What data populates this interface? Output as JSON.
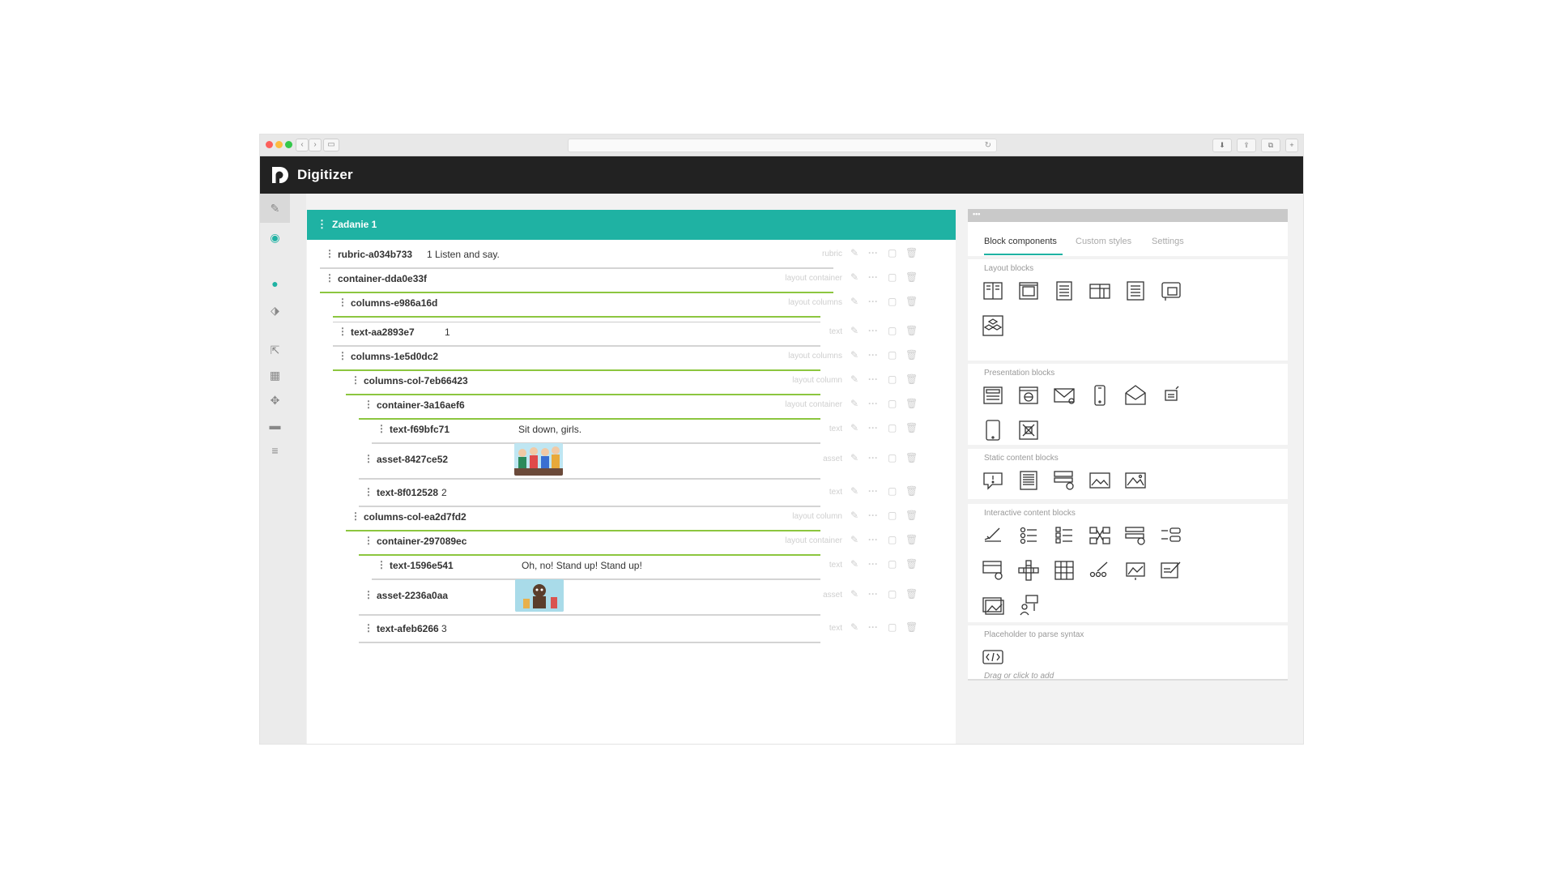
{
  "app": {
    "title": "Digitizer"
  },
  "task": {
    "title": "Zadanie 1"
  },
  "tree": [
    {
      "id": "rubric-a034b733",
      "value": "1 Listen and say.",
      "type": "rubric",
      "kind": "text"
    },
    {
      "id": "container-dda0e33f",
      "value": "",
      "type": "layout container",
      "kind": "text"
    },
    {
      "id": "columns-e986a16d",
      "value": "",
      "type": "layout columns",
      "kind": "text"
    },
    {
      "id": "text-aa2893e7",
      "value": "1",
      "type": "text",
      "kind": "text"
    },
    {
      "id": "columns-1e5d0dc2",
      "value": "",
      "type": "layout columns",
      "kind": "text"
    },
    {
      "id": "columns-col-7eb66423",
      "value": "",
      "type": "layout column",
      "kind": "text"
    },
    {
      "id": "container-3a16aef6",
      "value": "",
      "type": "layout container",
      "kind": "text"
    },
    {
      "id": "text-f69bfc71",
      "value": "Sit down, girls.",
      "type": "text",
      "kind": "text"
    },
    {
      "id": "asset-8427ce52",
      "value": "",
      "type": "asset",
      "kind": "image"
    },
    {
      "id": "text-8f012528",
      "value": "2",
      "type": "text",
      "kind": "text"
    },
    {
      "id": "columns-col-ea2d7fd2",
      "value": "",
      "type": "layout column",
      "kind": "text"
    },
    {
      "id": "container-297089ec",
      "value": "",
      "type": "layout container",
      "kind": "text"
    },
    {
      "id": "text-1596e541",
      "value": "Oh, no! Stand up! Stand up!",
      "type": "text",
      "kind": "text"
    },
    {
      "id": "asset-2236a0aa",
      "value": "",
      "type": "asset",
      "kind": "image"
    },
    {
      "id": "text-afeb6266",
      "value": "3",
      "type": "text",
      "kind": "text"
    }
  ],
  "panel": {
    "tabs": [
      "Block components",
      "Custom styles",
      "Settings"
    ],
    "sections": {
      "layout": "Layout blocks",
      "presentation": "Presentation blocks",
      "static": "Static content blocks",
      "interactive": "Interactive content blocks",
      "placeholder": "Placeholder to parse syntax"
    },
    "hint": "Drag or click to add",
    "topbar": "•••"
  },
  "colors": {
    "accent": "#1fb2a3",
    "nest_line": "#8cc63f",
    "header": "#222222"
  }
}
